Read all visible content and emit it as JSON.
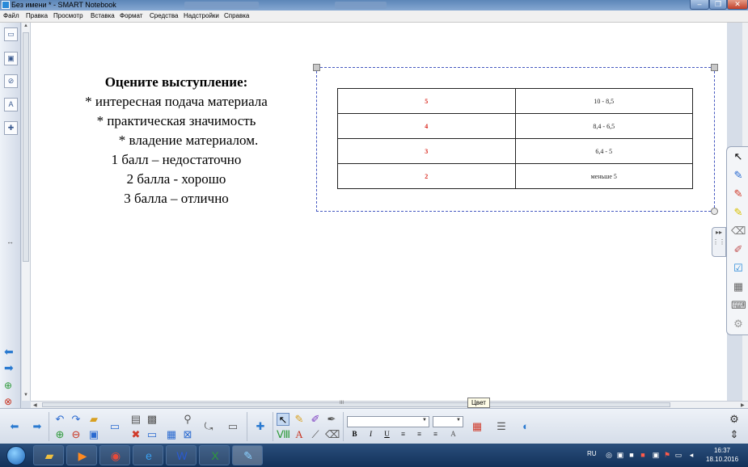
{
  "window": {
    "title": "Без имени * - SMART Notebook",
    "controls": {
      "minimize": "–",
      "maximize": "❐",
      "close": "✕"
    }
  },
  "menu": [
    "Файл",
    "Правка",
    "Просмотр",
    "Вставка",
    "Формат",
    "Средства",
    "Надстройки",
    "Справка"
  ],
  "slide": {
    "heading": "Оцените выступление:",
    "lines": [
      "* интересная подача материала",
      "* практическая значимость",
      "* владение материалом.",
      "1 балл – недостаточно",
      "2 балла - хорошо",
      "3 балла – отлично"
    ],
    "table": [
      {
        "score": "5",
        "range": "10 - 8,5"
      },
      {
        "score": "4",
        "range": "8,4 - 6,5"
      },
      {
        "score": "3",
        "range": "6,4 - 5"
      },
      {
        "score": "2",
        "range": "меньше 5"
      }
    ]
  },
  "tooltip": "Цвет",
  "taskbar": {
    "lang": "RU",
    "time": "16:37",
    "date": "18.10.2016"
  },
  "colors": {
    "score_red": "#d9261c",
    "selection_blue": "#4558c0",
    "taskbar": "#1e3f69"
  }
}
